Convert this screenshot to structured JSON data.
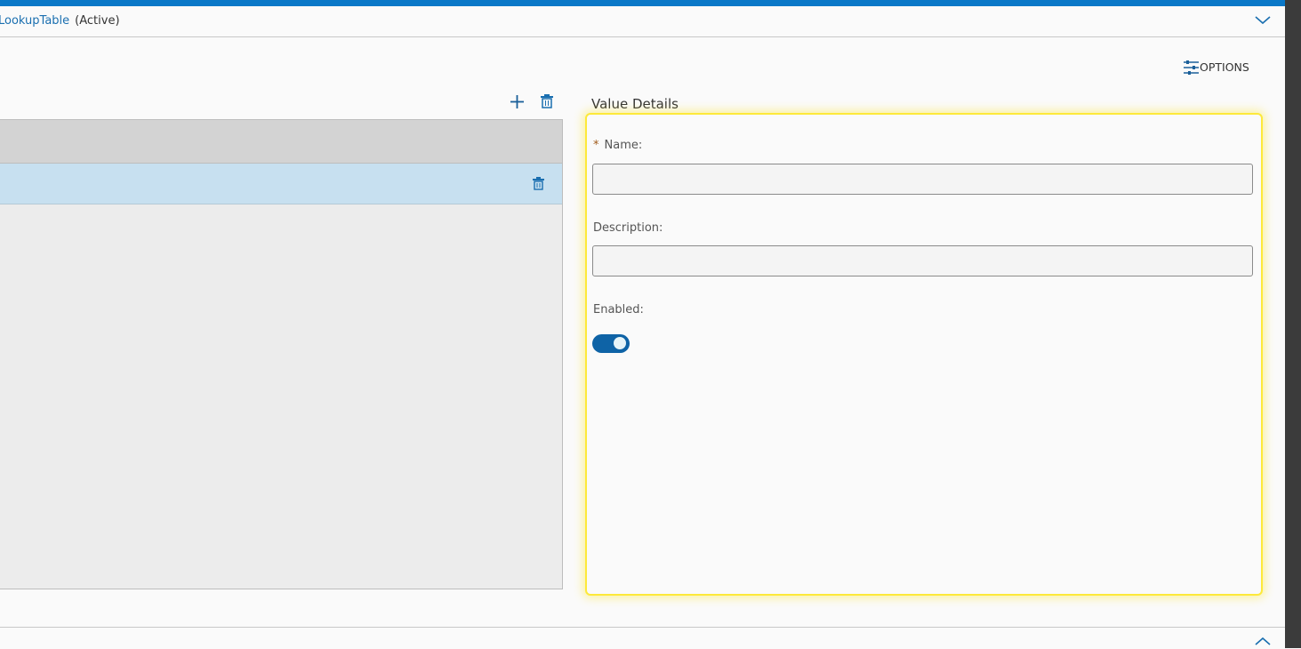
{
  "header": {
    "name": "LookupTable",
    "status": "(Active)",
    "collapse_icon": "chevron-down-icon"
  },
  "toolbar": {
    "options_label": "OPTIONS",
    "options_icon": "sliders-icon",
    "add_icon": "plus-icon",
    "delete_icon": "trash-icon"
  },
  "details": {
    "title": "Value Details",
    "required_marker": "*",
    "name_label": "Name:",
    "name_value": "",
    "description_label": "Description:",
    "description_value": "",
    "enabled_label": "Enabled:",
    "enabled": true
  },
  "footer": {
    "expand_icon": "chevron-up-icon"
  },
  "colors": {
    "accent": "#0a78c8",
    "toggle": "#0e63a6",
    "selected_row": "#c7e0f0",
    "highlight": "#fde93a"
  }
}
